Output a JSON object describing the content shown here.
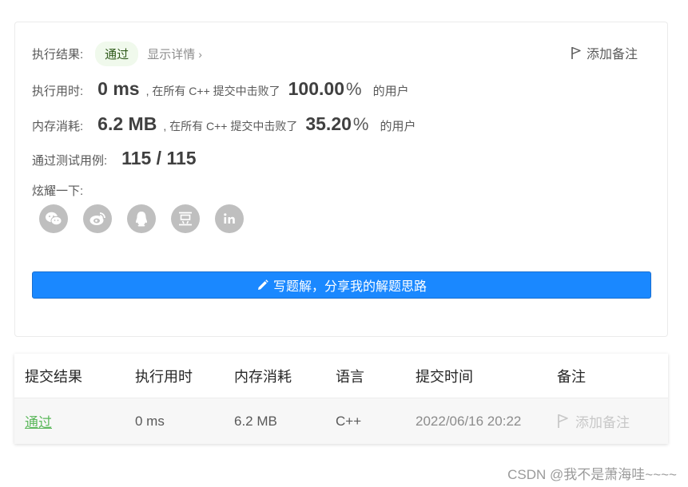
{
  "result": {
    "label": "执行结果:",
    "status": "通过",
    "show_details": "显示详情",
    "details_chevron": "›",
    "add_note": "添加备注"
  },
  "runtime": {
    "label": "执行用时:",
    "value": "0 ms",
    "beat_text": ", 在所有 C++ 提交中击败了",
    "percent": "100.00",
    "percent_sign": "%",
    "suffix": "的用户"
  },
  "memory": {
    "label": "内存消耗:",
    "value": "6.2 MB",
    "beat_text": ", 在所有 C++ 提交中击败了",
    "percent": "35.20",
    "percent_sign": "%",
    "suffix": "的用户"
  },
  "testcases": {
    "label": "通过测试用例:",
    "value": "115 / 115"
  },
  "share": {
    "label": "炫耀一下:",
    "icons": [
      "wechat-icon",
      "weibo-icon",
      "qq-icon",
      "douban-icon",
      "linkedin-icon"
    ]
  },
  "write_solution": {
    "label": "写题解，分享我的解题思路"
  },
  "table": {
    "headers": [
      "提交结果",
      "执行用时",
      "内存消耗",
      "语言",
      "提交时间",
      "备注"
    ],
    "rows": [
      {
        "status": "通过",
        "runtime": "0 ms",
        "memory": "6.2 MB",
        "language": "C++",
        "time": "2022/06/16 20:22",
        "note": "添加备注"
      }
    ]
  },
  "watermark": "CSDN @我不是萧海哇~~~~",
  "colors": {
    "accent": "#1a88ff",
    "success": "#5cb85c",
    "pill_bg": "#f0f9ec",
    "icon_bg": "#bfbfbf"
  }
}
